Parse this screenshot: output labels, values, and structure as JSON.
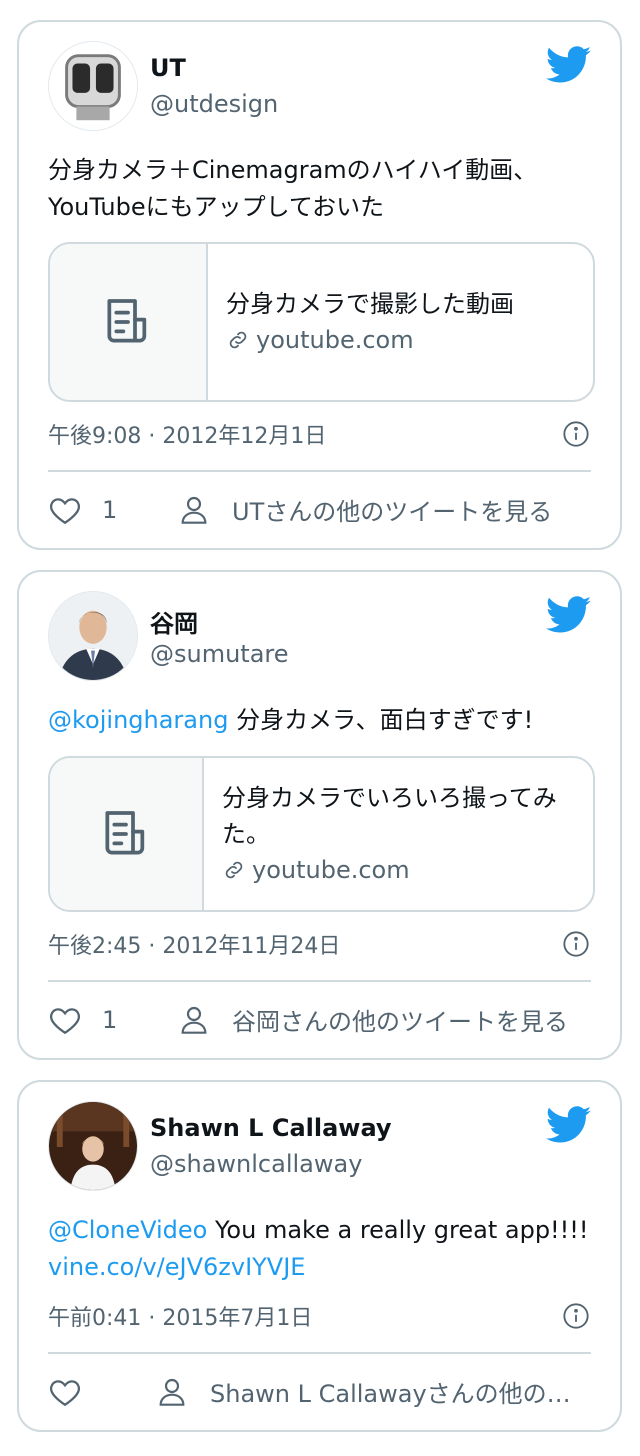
{
  "tweets": [
    {
      "name": "UT",
      "handle": "@utdesign",
      "text_lines": [
        "分身カメラ＋Cinemagramのハイハイ動画、",
        "YouTubeにもアップしておいた"
      ],
      "link_card": {
        "title": "分身カメラで撮影した動画",
        "domain": "youtube.com"
      },
      "timestamp": "午後9:08 · 2012年12月1日",
      "like_count": "1",
      "more_label": "UTさんの他のツイートを見る"
    },
    {
      "name": "谷岡",
      "handle": "@sumutare",
      "mention": "@kojingharang",
      "text": " 分身カメラ、面白すぎです!",
      "link_card": {
        "title": "分身カメラでいろいろ撮ってみた。",
        "domain": "youtube.com"
      },
      "timestamp": "午後2:45 · 2012年11月24日",
      "like_count": "1",
      "more_label": "谷岡さんの他のツイートを見る"
    },
    {
      "name": "Shawn L Callaway",
      "handle": "@shawnlcallaway",
      "mention": "@CloneVideo",
      "text": " You make a really great app!!!!",
      "link": "vine.co/v/eJV6zvIYVJE",
      "timestamp": "午前0:41 · 2015年7月1日",
      "like_count": "",
      "more_label": "Shawn L Callawayさんの他のツイートを見る"
    }
  ],
  "icons": {
    "brand": "twitter-bird-icon",
    "like": "heart-icon",
    "profile": "person-icon",
    "info": "info-icon",
    "link": "link-icon",
    "article": "document-icon"
  },
  "colors": {
    "brand": "#1d9bf0",
    "text": "#0f1419",
    "secondary": "#536471",
    "border": "#cfd9de"
  }
}
